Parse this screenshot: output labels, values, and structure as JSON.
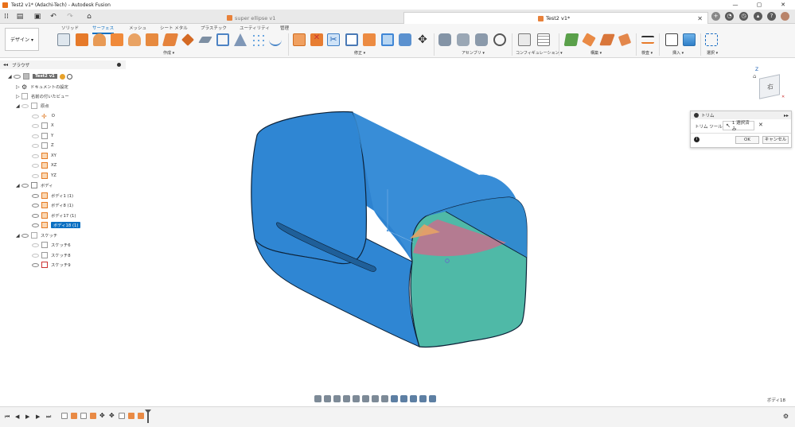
{
  "window": {
    "title": "Test2 v1* (Adachi-Tech) - Autodesk Fusion"
  },
  "tabs": [
    {
      "label": "super ellipse v1",
      "active": false
    },
    {
      "label": "Test2 v1*",
      "active": true
    }
  ],
  "ribbon": {
    "mode_button": "デザイン ▾",
    "workspace_tabs": [
      "ソリッド",
      "サーフェス",
      "メッシュ",
      "シート メタル",
      "プラスチック",
      "ユーティリティ",
      "管理"
    ],
    "active_tab": "サーフェス",
    "groups": [
      "作成 ▾",
      "修正 ▾",
      "アセンブリ ▾",
      "コンフィギュレーション ▾",
      "構築 ▾",
      "検査 ▾",
      "挿入 ▾",
      "選択 ▾"
    ]
  },
  "browser": {
    "header": "ブラウザ",
    "items": [
      {
        "label": "Test2 v1",
        "kind": "root"
      },
      {
        "label": "ドキュメントの設定",
        "kind": "settings"
      },
      {
        "label": "名前の付いたビュー",
        "kind": "folder"
      },
      {
        "label": "原点",
        "kind": "folder"
      },
      {
        "label": "O",
        "kind": "origin"
      },
      {
        "label": "X",
        "kind": "axis"
      },
      {
        "label": "Y",
        "kind": "axis"
      },
      {
        "label": "Z",
        "kind": "axis"
      },
      {
        "label": "XY",
        "kind": "plane"
      },
      {
        "label": "XZ",
        "kind": "plane"
      },
      {
        "label": "YZ",
        "kind": "plane"
      },
      {
        "label": "ボディ",
        "kind": "folder"
      },
      {
        "label": "ボディ1 (1)",
        "kind": "body"
      },
      {
        "label": "ボディ8 (1)",
        "kind": "body"
      },
      {
        "label": "ボディ17 (1)",
        "kind": "body"
      },
      {
        "label": "ボディ18 (1)",
        "kind": "body",
        "selected": true
      },
      {
        "label": "スケッチ",
        "kind": "folder"
      },
      {
        "label": "スケッチ6",
        "kind": "sketch"
      },
      {
        "label": "スケッチ8",
        "kind": "sketch"
      },
      {
        "label": "スケッチ9",
        "kind": "sketch"
      }
    ]
  },
  "viewcube": {
    "face_label": "右",
    "axis_label": "Z"
  },
  "trim_dialog": {
    "title": "トリム",
    "tool_label": "トリム ツール",
    "selection": "1 選択済み",
    "ok": "OK",
    "cancel": "キャンセル"
  },
  "status": {
    "selected_body": "ボディ18"
  },
  "colors": {
    "accent": "#0a6fc2",
    "surface_blue": "#2f85d1",
    "surface_teal": "#4fb9a7"
  }
}
